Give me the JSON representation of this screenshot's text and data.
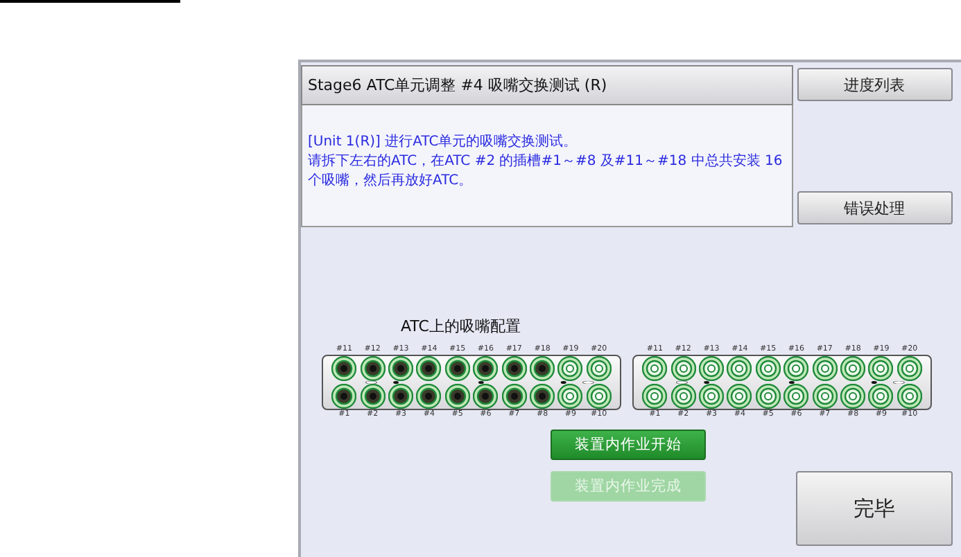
{
  "title": "Stage6 ATC单元调整 #4 吸嘴交换测试 (R)",
  "message": [
    "[Unit 1(R)] 进行ATC单元的吸嘴交换测试。",
    "请拆下左右的ATC，在ATC #2 的插槽#1～#8 及#11～#18 中总共安装 16 个吸嘴，然后再放好ATC。"
  ],
  "side_buttons": [
    {
      "label": "进度列表"
    },
    {
      "label": "错误处理"
    }
  ],
  "layout_title": "ATC上的吸嘴配置",
  "racks": [
    {
      "top": [
        {
          "label": "#11",
          "filled": true
        },
        {
          "label": "#12",
          "filled": true
        },
        {
          "label": "#13",
          "filled": true
        },
        {
          "label": "#14",
          "filled": true
        },
        {
          "label": "#15",
          "filled": true
        },
        {
          "label": "#16",
          "filled": true
        },
        {
          "label": "#17",
          "filled": true
        },
        {
          "label": "#18",
          "filled": true
        },
        {
          "label": "#19",
          "filled": false
        },
        {
          "label": "#20",
          "filled": false
        }
      ],
      "bottom": [
        {
          "label": "#1",
          "filled": true
        },
        {
          "label": "#2",
          "filled": true
        },
        {
          "label": "#3",
          "filled": true
        },
        {
          "label": "#4",
          "filled": true
        },
        {
          "label": "#5",
          "filled": true
        },
        {
          "label": "#6",
          "filled": true
        },
        {
          "label": "#7",
          "filled": true
        },
        {
          "label": "#8",
          "filled": true
        },
        {
          "label": "#9",
          "filled": false
        },
        {
          "label": "#10",
          "filled": false
        }
      ]
    },
    {
      "top": [
        {
          "label": "#11",
          "filled": false
        },
        {
          "label": "#12",
          "filled": false
        },
        {
          "label": "#13",
          "filled": false
        },
        {
          "label": "#14",
          "filled": false
        },
        {
          "label": "#15",
          "filled": false
        },
        {
          "label": "#16",
          "filled": false
        },
        {
          "label": "#17",
          "filled": false
        },
        {
          "label": "#18",
          "filled": false
        },
        {
          "label": "#19",
          "filled": false
        },
        {
          "label": "#20",
          "filled": false
        }
      ],
      "bottom": [
        {
          "label": "#1",
          "filled": false
        },
        {
          "label": "#2",
          "filled": false
        },
        {
          "label": "#3",
          "filled": false
        },
        {
          "label": "#4",
          "filled": false
        },
        {
          "label": "#5",
          "filled": false
        },
        {
          "label": "#6",
          "filled": false
        },
        {
          "label": "#7",
          "filled": false
        },
        {
          "label": "#8",
          "filled": false
        },
        {
          "label": "#9",
          "filled": false
        },
        {
          "label": "#10",
          "filled": false
        }
      ]
    }
  ],
  "work_buttons": [
    {
      "label": "装置内作业开始",
      "disabled": false
    },
    {
      "label": "装置内作业完成",
      "disabled": true
    }
  ],
  "finish_button": {
    "label": "完毕"
  }
}
